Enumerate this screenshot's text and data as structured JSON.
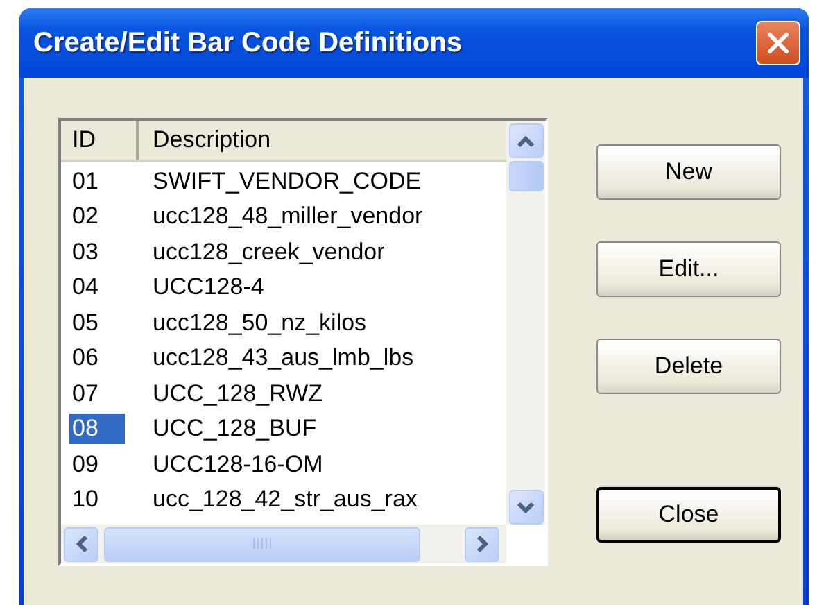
{
  "window": {
    "title": "Create/Edit Bar Code Definitions"
  },
  "list": {
    "columns": [
      "ID",
      "Description"
    ],
    "rows": [
      {
        "id": "01",
        "description": "SWIFT_VENDOR_CODE",
        "selected": false
      },
      {
        "id": "02",
        "description": "ucc128_48_miller_vendor",
        "selected": false
      },
      {
        "id": "03",
        "description": "ucc128_creek_vendor",
        "selected": false
      },
      {
        "id": "04",
        "description": "UCC128-4",
        "selected": false
      },
      {
        "id": "05",
        "description": "ucc128_50_nz_kilos",
        "selected": false
      },
      {
        "id": "06",
        "description": "ucc128_43_aus_lmb_lbs",
        "selected": false
      },
      {
        "id": "07",
        "description": "UCC_128_RWZ",
        "selected": false
      },
      {
        "id": "08",
        "description": "UCC_128_BUF",
        "selected": true
      },
      {
        "id": "09",
        "description": "UCC128-16-OM",
        "selected": false
      },
      {
        "id": "10",
        "description": "ucc_128_42_str_aus_rax",
        "selected": false
      }
    ]
  },
  "buttons": [
    {
      "label": "New",
      "default": false
    },
    {
      "label": "Edit...",
      "default": false
    },
    {
      "label": "Delete",
      "default": false
    },
    {
      "label": "Close",
      "default": true
    }
  ]
}
